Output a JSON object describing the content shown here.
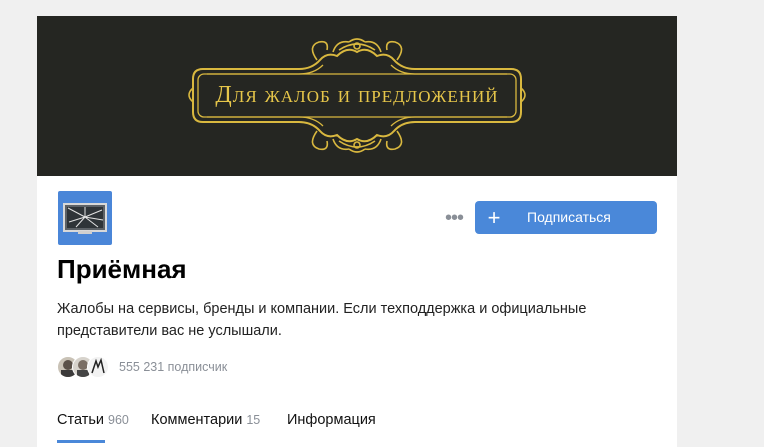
{
  "banner": {
    "text": "Для жалоб и предложений"
  },
  "channel": {
    "name": "Приёмная",
    "description": "Жалобы на сервисы, бренды и компании. Если техподдержка и официальные представители вас не услышали.",
    "followers": "555 231 подписчик"
  },
  "actions": {
    "more_label": "•••",
    "subscribe_plus": "+",
    "subscribe_label": "Подписаться"
  },
  "tabs": [
    {
      "label": "Статьи",
      "count": "960",
      "active": true
    },
    {
      "label": "Комментарии",
      "count": "15",
      "active": false
    },
    {
      "label": "Информация",
      "count": "",
      "active": false
    }
  ],
  "colors": {
    "accent": "#4a88d9",
    "banner_bg": "#252622",
    "banner_gold": "#e6c64a",
    "muted_text": "#8a8f97"
  },
  "icons": {
    "avatar": "broken-screen-avatar",
    "more": "more-dots-icon",
    "plus": "plus-icon"
  }
}
